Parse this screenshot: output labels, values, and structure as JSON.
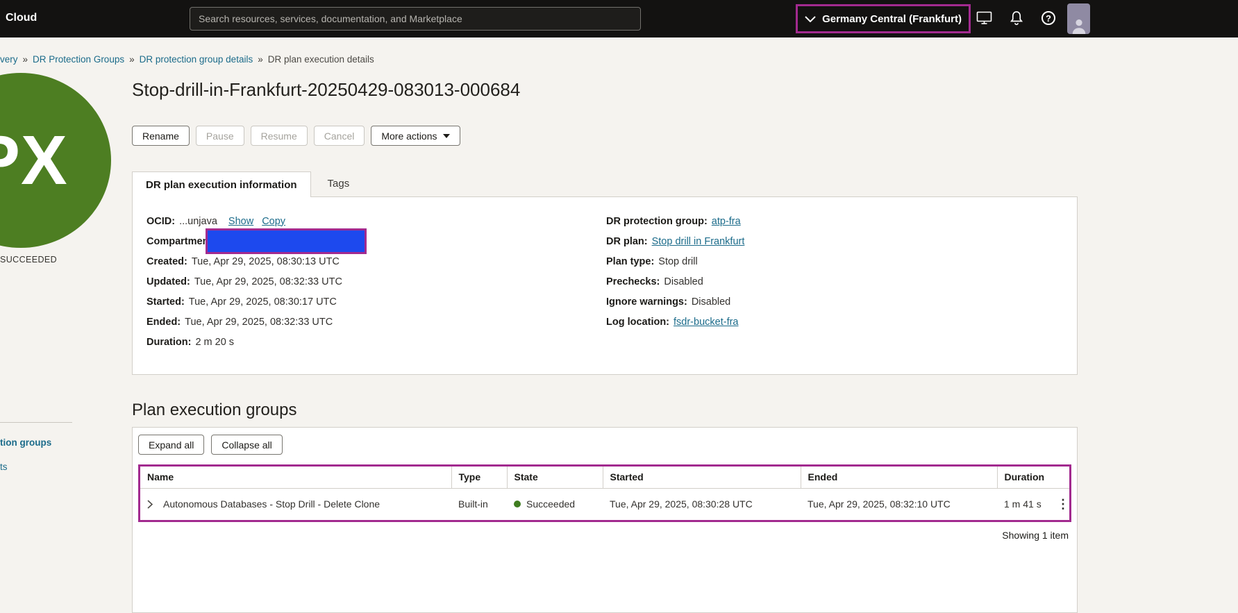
{
  "colors": {
    "annotation_purple": "#A22A8F",
    "redaction_blue": "#1D49EE",
    "success_green": "#4D7E22",
    "link_teal": "#1B6B8A",
    "topbar_black": "#131211"
  },
  "topbar": {
    "brand": "Cloud",
    "search_placeholder": "Search resources, services, documentation, and Marketplace",
    "region": "Germany Central (Frankfurt)"
  },
  "glyphs": {
    "help": "?",
    "kebab": "⋮",
    "separator": "»"
  },
  "breadcrumb": {
    "root": "very",
    "link1": "DR Protection Groups",
    "link2": "DR protection group details",
    "current": "DR plan execution details"
  },
  "sidebar": {
    "item1": "tion groups",
    "item2": "ts"
  },
  "status": {
    "initials": "PX",
    "label": "SUCCEEDED"
  },
  "page": {
    "title": "Stop-drill-in-Frankfurt-20250429-083013-000684"
  },
  "actions": {
    "rename": "Rename",
    "pause": "Pause",
    "resume": "Resume",
    "cancel": "Cancel",
    "more": "More actions"
  },
  "tabs": {
    "info": "DR plan execution information",
    "tags": "Tags"
  },
  "details": {
    "ocid_label": "OCID:",
    "ocid_value": "...unjava",
    "show_link": "Show",
    "copy_link": "Copy",
    "compartment_label": "Compartment:",
    "created_label": "Created:",
    "created_value": "Tue, Apr 29, 2025, 08:30:13 UTC",
    "updated_label": "Updated:",
    "updated_value": "Tue, Apr 29, 2025, 08:32:33 UTC",
    "started_label": "Started:",
    "started_value": "Tue, Apr 29, 2025, 08:30:17 UTC",
    "ended_label": "Ended:",
    "ended_value": "Tue, Apr 29, 2025, 08:32:33 UTC",
    "duration_label": "Duration:",
    "duration_value": "2 m 20 s",
    "dpg_label": "DR protection group:",
    "dpg_value": "atp-fra",
    "plan_label": "DR plan:",
    "plan_value": "Stop drill in Frankfurt",
    "plan_type_label": "Plan type:",
    "plan_type_value": "Stop drill",
    "prechecks_label": "Prechecks:",
    "prechecks_value": "Disabled",
    "ignore_label": "Ignore warnings:",
    "ignore_value": "Disabled",
    "log_label": "Log location:",
    "log_value": "fsdr-bucket-fra"
  },
  "groups": {
    "heading": "Plan execution groups",
    "expand_all": "Expand all",
    "collapse_all": "Collapse all",
    "columns": [
      "Name",
      "Type",
      "State",
      "Started",
      "Ended",
      "Duration"
    ],
    "row": {
      "name": "Autonomous Databases - Stop Drill - Delete Clone",
      "type": "Built-in",
      "state": "Succeeded",
      "started": "Tue, Apr 29, 2025, 08:30:28 UTC",
      "ended": "Tue, Apr 29, 2025, 08:32:10 UTC",
      "duration": "1 m 41 s"
    },
    "footer": "Showing 1 item"
  }
}
